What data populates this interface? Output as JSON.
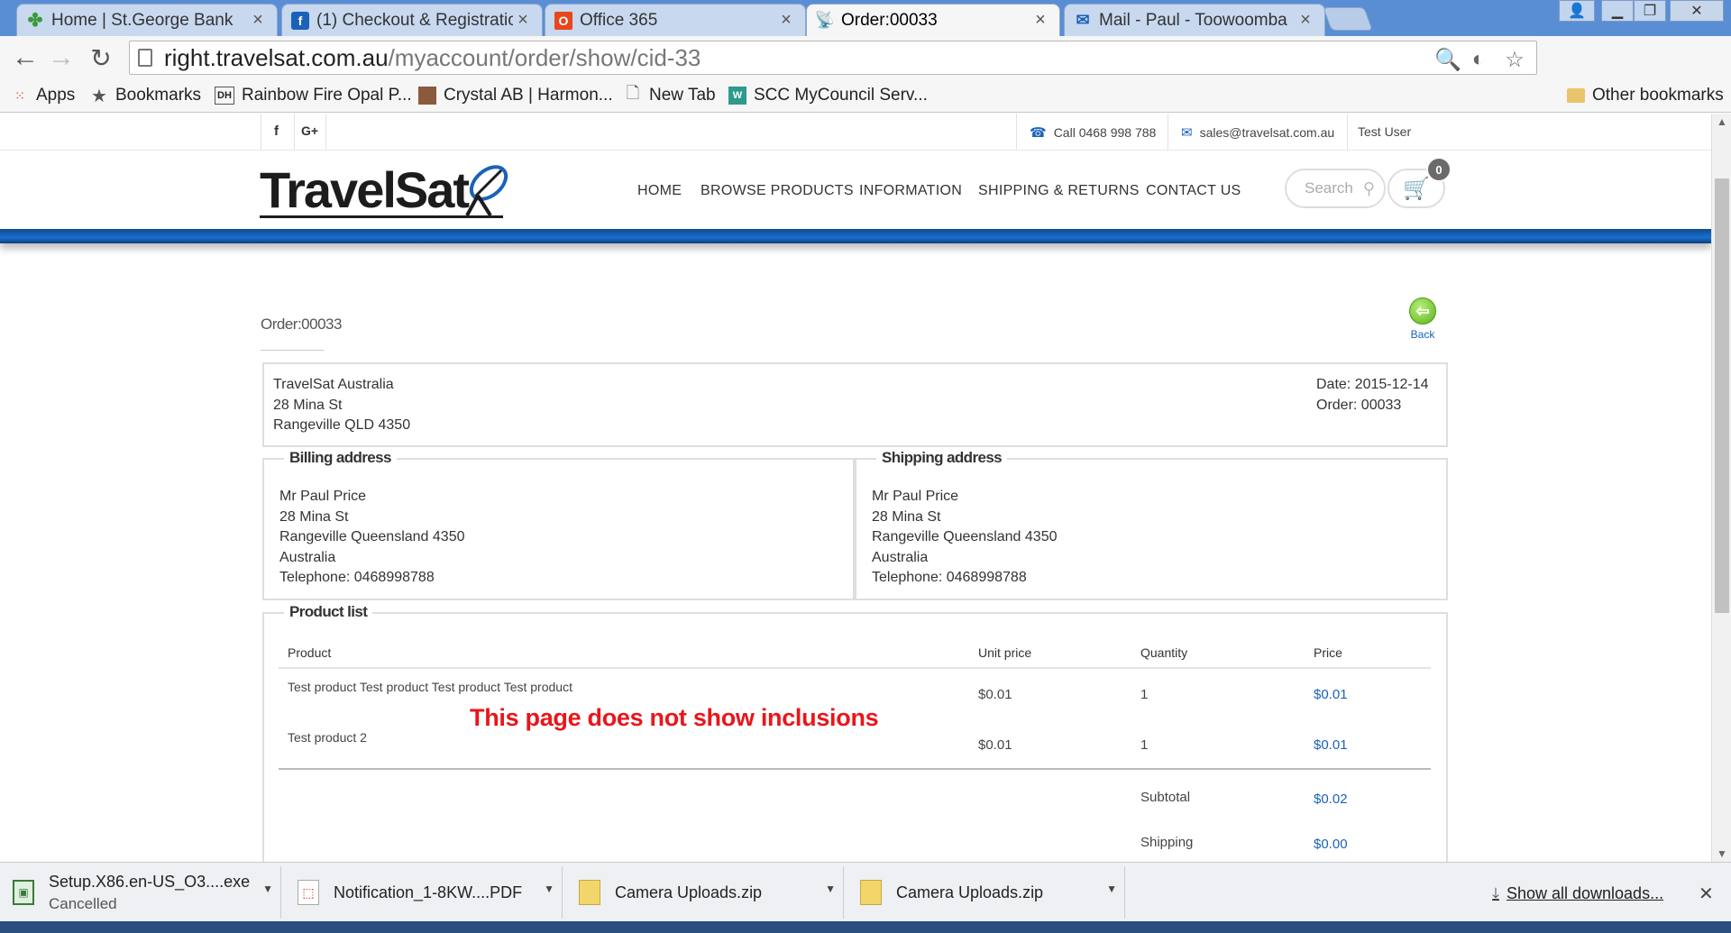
{
  "browser": {
    "tabs": [
      {
        "title": "Home | St.George Bank",
        "favicon_color": "#3a9a3a",
        "active": false
      },
      {
        "title": "(1) Checkout & Registratio",
        "favicon_color": "#1a62b9",
        "active": false
      },
      {
        "title": "Office 365",
        "favicon_color": "#e8461b",
        "active": false
      },
      {
        "title": "Order:00033",
        "favicon_color": "#333333",
        "active": true
      },
      {
        "title": "Mail - Paul - Toowoomba",
        "favicon_color": "#1a62b9",
        "active": false
      }
    ],
    "url_host": "right.travelsat.com.au",
    "url_path": "/myaccount/order/show/cid-33",
    "bookmarks": [
      {
        "label": "Apps",
        "icon": "apps-grid-icon"
      },
      {
        "label": "Bookmarks",
        "icon": "star-icon"
      },
      {
        "label": "Rainbow Fire Opal P...",
        "icon": "dh-icon"
      },
      {
        "label": "Crystal AB | Harmon...",
        "icon": "photo-icon"
      },
      {
        "label": "New Tab",
        "icon": "page-icon"
      },
      {
        "label": "SCC MyCouncil Serv...",
        "icon": "scc-icon"
      }
    ],
    "other_bookmarks": "Other bookmarks"
  },
  "site": {
    "social": {
      "facebook": "f",
      "google_plus": "G+"
    },
    "phone": "Call 0468 998 788",
    "email": "sales@travelsat.com.au",
    "user": "Test User",
    "logo_text": "TravelSat",
    "nav": [
      "HOME",
      "BROWSE PRODUCTS",
      "INFORMATION",
      "SHIPPING & RETURNS",
      "CONTACT US"
    ],
    "search_placeholder": "Search",
    "cart_count": "0",
    "brand_blue": "#1a62b9"
  },
  "order": {
    "title": "Order:00033",
    "back_label": "Back",
    "seller": {
      "name": "TravelSat Australia",
      "street": "28 Mina St",
      "city": "Rangeville QLD 4350"
    },
    "date": "Date: 2015-12-14",
    "order_no": "Order: 00033",
    "billing": {
      "legend": "Billing address",
      "name": "Mr Paul Price",
      "street": "28 Mina St",
      "city": "Rangeville Queensland 4350",
      "country": "Australia",
      "phone": "Telephone: 0468998788"
    },
    "shipping": {
      "legend": "Shipping address",
      "name": "Mr Paul Price",
      "street": "28 Mina St",
      "city": "Rangeville Queensland 4350",
      "country": "Australia",
      "phone": "Telephone: 0468998788"
    },
    "product_list": {
      "legend": "Product list",
      "columns": [
        "Product",
        "Unit price",
        "Quantity",
        "Price"
      ],
      "rows": [
        {
          "product": "Test product Test product Test product Test product",
          "unit": "$0.01",
          "qty": "1",
          "price": "$0.01"
        },
        {
          "product": "Test product 2",
          "unit": "$0.01",
          "qty": "1",
          "price": "$0.01"
        }
      ],
      "subtotal_label": "Subtotal",
      "subtotal": "$0.02",
      "shipping_label": "Shipping",
      "shipping": "$0.00"
    },
    "annotation": "This page does not show inclusions"
  },
  "downloads": {
    "items": [
      {
        "name": "Setup.X86.en-US_O3....exe",
        "status": "Cancelled",
        "icon": "installer-icon"
      },
      {
        "name": "Notification_1-8KW....PDF",
        "status": "",
        "icon": "pdf-icon"
      },
      {
        "name": "Camera Uploads.zip",
        "status": "",
        "icon": "zip-icon"
      },
      {
        "name": "Camera Uploads.zip",
        "status": "",
        "icon": "zip-icon"
      }
    ],
    "show_all": "Show all downloads..."
  }
}
